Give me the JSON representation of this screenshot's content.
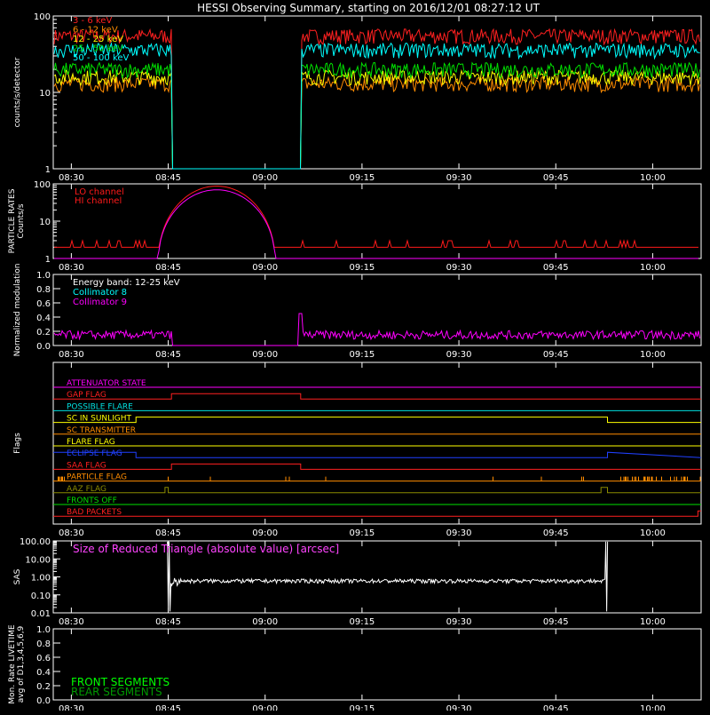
{
  "title": "HESSI Observing Summary, starting on 2016/12/01 08:27:12 UT",
  "x_ticks": [
    "08:30",
    "08:45",
    "09:00",
    "09:15",
    "09:30",
    "09:45",
    "10:00"
  ],
  "colors": {
    "c3_6": "#ff2020",
    "c6_12": "#ff8c00",
    "c12_25": "#ffff00",
    "c25_50": "#00e000",
    "c50_100": "#00ffff",
    "lo": "#ff1a1a",
    "hi": "#ff00ff",
    "coll8": "#00ffff",
    "coll9": "#ff00ff",
    "sas": "#ff44ff",
    "front": "#00ff00",
    "rear": "#009900"
  },
  "chart_data": [
    {
      "type": "line",
      "panel": "count-rates",
      "ylabel": "counts/s/detector",
      "yscale": "log",
      "ylim": [
        1,
        100
      ],
      "y_ticks": [
        "100",
        "10",
        "1"
      ],
      "data_gap": [
        "08:45:30",
        "09:05:30"
      ],
      "series": [
        {
          "name": "3 - 6 keV",
          "color_key": "c3_6",
          "level": 55
        },
        {
          "name": "6 - 12 keV",
          "color_key": "c6_12",
          "level": 13
        },
        {
          "name": "12 - 25 keV",
          "color_key": "c12_25",
          "level": 16
        },
        {
          "name": "25 - 50 keV",
          "color_key": "c25_50",
          "level": 20
        },
        {
          "name": "50 - 100 keV",
          "color_key": "c50_100",
          "level": 36
        }
      ]
    },
    {
      "type": "line",
      "panel": "particle-rates",
      "ylabel": "PARTICLE RATES Counts/s",
      "yscale": "log",
      "ylim": [
        1,
        100
      ],
      "y_ticks": [
        "100",
        "10",
        "1"
      ],
      "series": [
        {
          "name": "LO channel",
          "color_key": "lo"
        },
        {
          "name": "HI channel",
          "color_key": "hi"
        }
      ]
    },
    {
      "type": "line",
      "panel": "modulation",
      "ylabel": "Normalized modulation",
      "ylim": [
        0,
        1
      ],
      "y_ticks": [
        "1.0",
        "0.8",
        "0.6",
        "0.4",
        "0.2",
        "0.0"
      ],
      "annotation": "Energy band: 12-25 keV",
      "series": [
        {
          "name": "Collimator 8",
          "color_key": "coll8"
        },
        {
          "name": "Collimator 9",
          "color_key": "coll9",
          "level": 0.15
        }
      ]
    },
    {
      "type": "line",
      "panel": "flags",
      "ylabel": "Flags",
      "series": [
        {
          "name": "ATTENUATOR STATE",
          "color": "#ff00ff",
          "transitions": []
        },
        {
          "name": "GAP FLAG",
          "color": "#ff2020",
          "transitions": [
            "08:45:30",
            "09:05:30"
          ]
        },
        {
          "name": "POSSIBLE FLARE",
          "color": "#00e0e0",
          "transitions": []
        },
        {
          "name": "SC IN SUNLIGHT",
          "color": "#ffff00",
          "transitions": [
            "08:40:00",
            "09:53:00"
          ]
        },
        {
          "name": "SC TRANSMITTER",
          "color": "#ff8c00",
          "transitions": []
        },
        {
          "name": "FLARE FLAG",
          "color": "#ffff00",
          "transitions": []
        },
        {
          "name": "ECLIPSE FLAG",
          "color": "#2040ff",
          "transitions": [
            "08:40:00",
            "09:53:00"
          ]
        },
        {
          "name": "SAA FLAG",
          "color": "#ff2020",
          "transitions": [
            "08:45:30",
            "09:05:30"
          ]
        },
        {
          "name": "PARTICLE FLAG",
          "color": "#ff8c00",
          "transitions": []
        },
        {
          "name": "AAZ FLAG",
          "color": "#8b8b00",
          "transitions": [
            "08:44:30",
            "08:45:00",
            "09:52:00",
            "09:53:00"
          ]
        },
        {
          "name": "FRONTS OFF",
          "color": "#00e000",
          "transitions": []
        },
        {
          "name": "BAD PACKETS",
          "color": "#ff2020",
          "transitions": [
            "10:07:00"
          ]
        }
      ]
    },
    {
      "type": "line",
      "panel": "sas",
      "ylabel": "SAS",
      "yscale": "log",
      "ylim": [
        0.01,
        100
      ],
      "y_ticks": [
        "100.00",
        "10.00",
        "1.00",
        "0.10",
        "0.01"
      ],
      "annotation": "Size of Reduced Triangle (absolute value) [arcsec]",
      "series": [
        {
          "name": "",
          "color": "#ffffff",
          "level": 0.6,
          "spikes": [
            "08:45:00",
            "09:53:00"
          ]
        }
      ]
    },
    {
      "type": "line",
      "panel": "livetime",
      "ylabel": "Mon. Rate LIVETIME avg of D1,3,4,5,6,9",
      "ylim": [
        0,
        1
      ],
      "y_ticks": [
        "1.0",
        "0.8",
        "0.6",
        "0.4",
        "0.2",
        "0.0"
      ],
      "series": [
        {
          "name": "FRONT SEGMENTS",
          "color_key": "front"
        },
        {
          "name": "REAR SEGMENTS",
          "color_key": "rear"
        }
      ]
    }
  ]
}
